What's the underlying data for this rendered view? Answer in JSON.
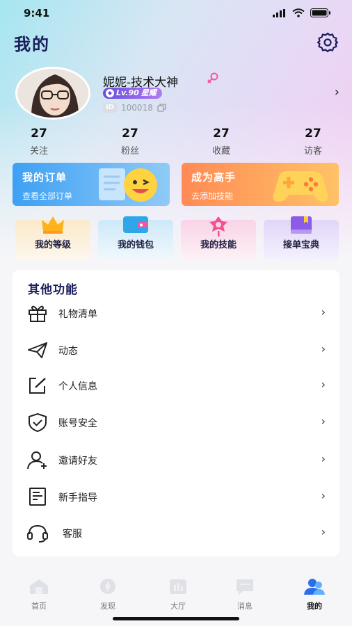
{
  "status_bar": {
    "time": "9:41"
  },
  "header": {
    "title": "我的"
  },
  "profile": {
    "nickname": "妮妮-技术大神",
    "level": "Lv.90",
    "level_tag": "星耀",
    "id_label": "ID",
    "id_value": "100018"
  },
  "stats": [
    {
      "value": "27",
      "label": "关注"
    },
    {
      "value": "27",
      "label": "粉丝"
    },
    {
      "value": "27",
      "label": "收藏"
    },
    {
      "value": "27",
      "label": "访客"
    }
  ],
  "promo_cards": [
    {
      "title": "我的订单",
      "subtitle": "查看全部订单"
    },
    {
      "title": "成为高手",
      "subtitle": "去添加技能"
    }
  ],
  "quick_cards": [
    "我的等级",
    "我的钱包",
    "我的技能",
    "接单宝典"
  ],
  "functions": {
    "title": "其他功能",
    "items": [
      "礼物清单",
      "动态",
      "个人信息",
      "账号安全",
      "邀请好友",
      "新手指导",
      "客服"
    ]
  },
  "tabbar": {
    "tabs": [
      "首页",
      "发现",
      "大厅",
      "消息",
      "我的"
    ],
    "active": "我的"
  },
  "colors": {
    "title": "#1b1e5c",
    "order_card": "#3ea0f4",
    "expert_card": "#ff8a55",
    "level_badge": "#6a4ce0"
  }
}
